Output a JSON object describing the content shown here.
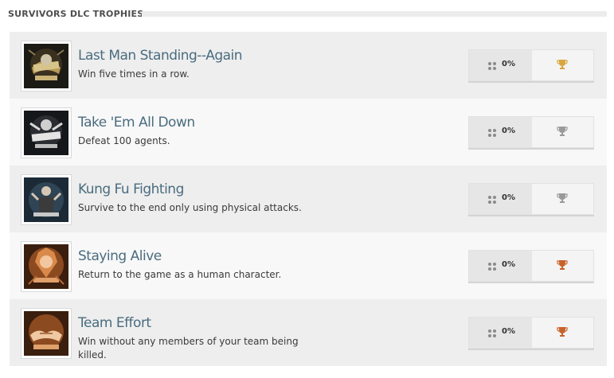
{
  "section": {
    "title": "SURVIVORS DLC TROPHIES"
  },
  "trophies": [
    {
      "name": "Last Man Standing--Again",
      "description": "Win five times in a row.",
      "percent": "0%",
      "grade": "gold",
      "grade_color": "#d9a640",
      "art": "dark-gold"
    },
    {
      "name": "Take 'Em All Down",
      "description": "Defeat 100 agents.",
      "percent": "0%",
      "grade": "silver",
      "grade_color": "#9a9a9a",
      "art": "dark-silver"
    },
    {
      "name": "Kung Fu Fighting",
      "description": "Survive to the end only using physical attacks.",
      "percent": "0%",
      "grade": "silver",
      "grade_color": "#9a9a9a",
      "art": "dark-blue"
    },
    {
      "name": "Staying Alive",
      "description": "Return to the game as a human character.",
      "percent": "0%",
      "grade": "bronze",
      "grade_color": "#c8622b",
      "art": "orange"
    },
    {
      "name": "Team Effort",
      "description": "Win without any members of your team being killed.",
      "percent": "0%",
      "grade": "bronze",
      "grade_color": "#c8622b",
      "art": "orange"
    }
  ]
}
